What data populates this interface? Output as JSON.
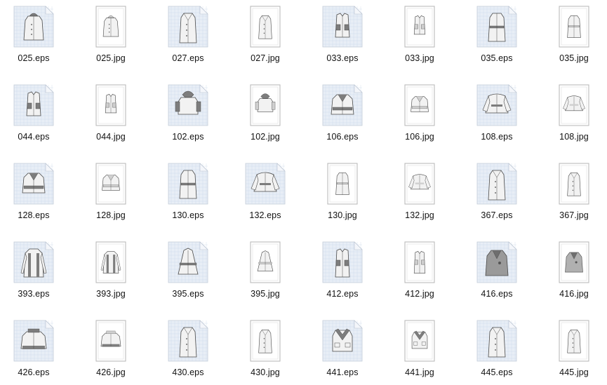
{
  "files": [
    {
      "name": "025.eps",
      "type": "eps",
      "icon": "coat-hood-icon"
    },
    {
      "name": "025.jpg",
      "type": "jpg",
      "icon": "coat-hood-icon"
    },
    {
      "name": "027.eps",
      "type": "eps",
      "icon": "coat-long-icon"
    },
    {
      "name": "027.jpg",
      "type": "jpg",
      "icon": "coat-long-icon"
    },
    {
      "name": "033.eps",
      "type": "eps",
      "icon": "vest-icon"
    },
    {
      "name": "033.jpg",
      "type": "jpg",
      "icon": "vest-icon"
    },
    {
      "name": "035.eps",
      "type": "eps",
      "icon": "coat-belted-icon"
    },
    {
      "name": "035.jpg",
      "type": "jpg",
      "icon": "coat-belted-icon"
    },
    {
      "name": "044.eps",
      "type": "eps",
      "icon": "vest-dark-icon"
    },
    {
      "name": "044.jpg",
      "type": "jpg",
      "icon": "vest-dark-icon"
    },
    {
      "name": "102.eps",
      "type": "eps",
      "icon": "jacket-hood-icon"
    },
    {
      "name": "102.jpg",
      "type": "jpg",
      "icon": "jacket-hood-icon"
    },
    {
      "name": "106.eps",
      "type": "eps",
      "icon": "jacket-icon"
    },
    {
      "name": "106.jpg",
      "type": "jpg",
      "icon": "jacket-icon"
    },
    {
      "name": "108.eps",
      "type": "eps",
      "icon": "jacket-puffy-icon"
    },
    {
      "name": "108.jpg",
      "type": "jpg",
      "icon": "jacket-puffy-icon"
    },
    {
      "name": "128.eps",
      "type": "eps",
      "icon": "jacket-icon"
    },
    {
      "name": "128.jpg",
      "type": "jpg",
      "icon": "jacket-icon"
    },
    {
      "name": "130.eps",
      "type": "eps",
      "icon": "coat-belted-icon"
    },
    {
      "name": "132.eps",
      "type": "eps",
      "icon": "jacket-puffy-icon"
    },
    {
      "name": "130.jpg",
      "type": "jpg",
      "icon": "coat-belted-icon"
    },
    {
      "name": "132.jpg",
      "type": "jpg",
      "icon": "jacket-puffy-icon"
    },
    {
      "name": "367.eps",
      "type": "eps",
      "icon": "coat-long-icon"
    },
    {
      "name": "367.jpg",
      "type": "jpg",
      "icon": "coat-long-icon"
    },
    {
      "name": "393.eps",
      "type": "eps",
      "icon": "coat-striped-icon"
    },
    {
      "name": "393.jpg",
      "type": "jpg",
      "icon": "coat-striped-icon"
    },
    {
      "name": "395.eps",
      "type": "eps",
      "icon": "cape-icon"
    },
    {
      "name": "395.jpg",
      "type": "jpg",
      "icon": "cape-icon"
    },
    {
      "name": "412.eps",
      "type": "eps",
      "icon": "vest-long-icon"
    },
    {
      "name": "412.jpg",
      "type": "jpg",
      "icon": "vest-long-icon"
    },
    {
      "name": "416.eps",
      "type": "eps",
      "icon": "coat-grey-icon"
    },
    {
      "name": "416.jpg",
      "type": "jpg",
      "icon": "coat-grey-icon"
    },
    {
      "name": "426.eps",
      "type": "eps",
      "icon": "jacket-bomber-icon"
    },
    {
      "name": "426.jpg",
      "type": "jpg",
      "icon": "jacket-bomber-icon"
    },
    {
      "name": "430.eps",
      "type": "eps",
      "icon": "coat-long-icon"
    },
    {
      "name": "430.jpg",
      "type": "jpg",
      "icon": "coat-long-icon"
    },
    {
      "name": "441.eps",
      "type": "eps",
      "icon": "jacket-collar-icon"
    },
    {
      "name": "441.jpg",
      "type": "jpg",
      "icon": "jacket-collar-icon"
    },
    {
      "name": "445.eps",
      "type": "eps",
      "icon": "coat-long-icon"
    },
    {
      "name": "445.jpg",
      "type": "jpg",
      "icon": "coat-long-icon"
    }
  ],
  "colors": {
    "eps_page": "#e8eef6",
    "eps_grid": "#c9d6e8",
    "eps_fold": "#f4f6fa",
    "jpg_border": "#b5b5b5",
    "garment_fill": "#f2f2f2",
    "garment_dark": "#7d7d7d",
    "garment_stroke": "#4a4a4a"
  }
}
